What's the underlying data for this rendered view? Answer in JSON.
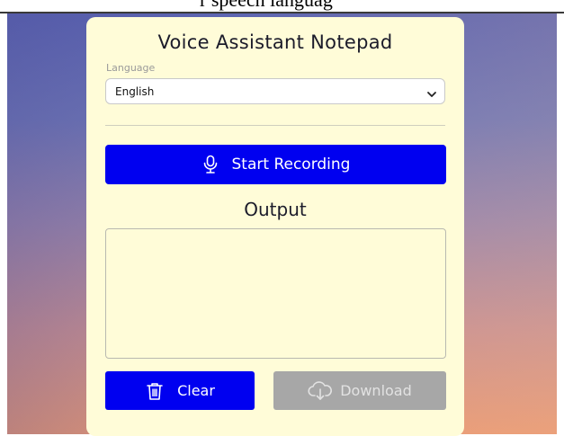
{
  "page": {
    "top_caption": "r speech languag"
  },
  "card": {
    "title": "Voice Assistant Notepad",
    "language_label": "Language",
    "language_value": "English",
    "record_button_label": "Start Recording",
    "output_heading": "Output",
    "output_text": "",
    "clear_button_label": "Clear",
    "download_button_label": "Download"
  },
  "icons": {
    "select": "chevron-down-icon",
    "record": "microphone-icon",
    "clear": "trash-icon",
    "download": "cloud-download-icon"
  },
  "colors": {
    "card_background": "#fffcd8",
    "primary_button": "#0000f0",
    "disabled_button": "#a7a7a7"
  }
}
